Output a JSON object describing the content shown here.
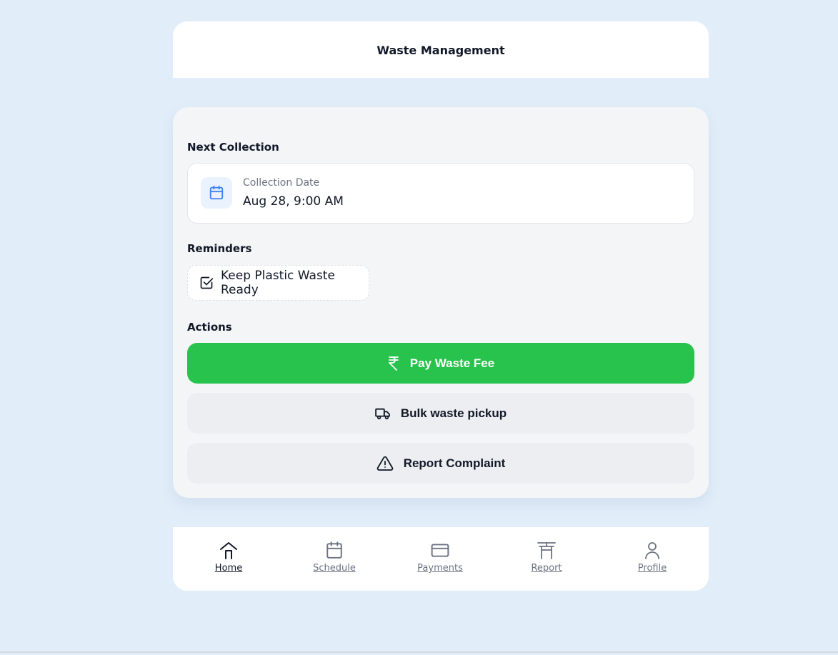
{
  "header": {
    "title": "Waste Management"
  },
  "next_collection": {
    "heading": "Next Collection",
    "label": "Collection Date",
    "value": "Aug 28, 9:00 AM",
    "icon": "calendar-icon"
  },
  "reminders": {
    "heading": "Reminders",
    "items": [
      {
        "label": "Keep Plastic Waste Ready",
        "icon": "checkbox-checked-icon"
      }
    ]
  },
  "actions": {
    "heading": "Actions",
    "buttons": [
      {
        "label": "Pay Waste Fee",
        "icon": "rupee-icon"
      },
      {
        "label": "Bulk waste pickup",
        "icon": "truck-icon"
      },
      {
        "label": "Report Complaint",
        "icon": "warning-icon"
      }
    ]
  },
  "nav": {
    "items": [
      {
        "label": "Home",
        "icon": "home-icon",
        "active": true
      },
      {
        "label": "Schedule",
        "icon": "calendar-icon",
        "active": false
      },
      {
        "label": "Payments",
        "icon": "credit-card-icon",
        "active": false
      },
      {
        "label": "Report",
        "icon": "torii-gate-icon",
        "active": false
      },
      {
        "label": "Profile",
        "icon": "user-icon",
        "active": false
      }
    ]
  },
  "colors": {
    "background": "#e1edf9",
    "primary_green": "#28c34d",
    "accent_blue": "#3b82f6",
    "text_dark": "#111827",
    "text_muted": "#6b7280"
  }
}
